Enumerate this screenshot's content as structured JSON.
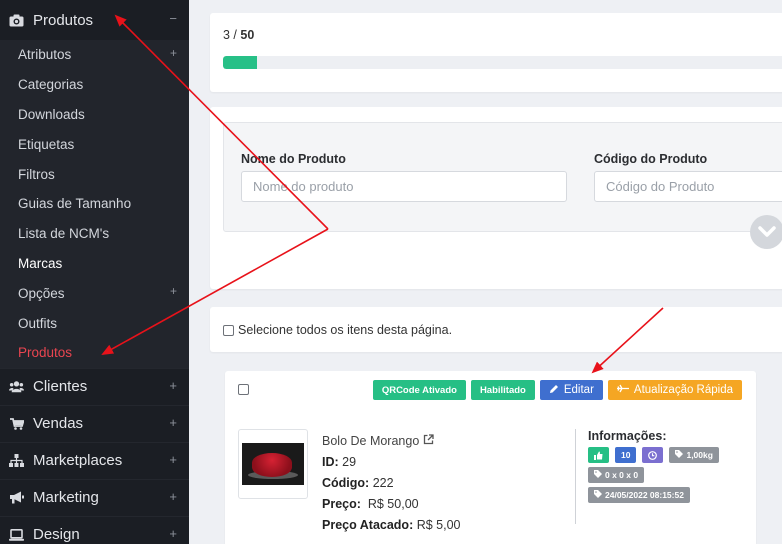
{
  "sidebar": {
    "top": {
      "label": "Produtos",
      "sign": "−"
    },
    "submenu": [
      {
        "label": "Atributos",
        "sign": "+"
      },
      {
        "label": "Categorias",
        "sign": ""
      },
      {
        "label": "Downloads",
        "sign": ""
      },
      {
        "label": "Etiquetas",
        "sign": ""
      },
      {
        "label": "Filtros",
        "sign": ""
      },
      {
        "label": "Guias de Tamanho",
        "sign": ""
      },
      {
        "label": "Lista de NCM's",
        "sign": ""
      },
      {
        "label": "Marcas",
        "sign": ""
      },
      {
        "label": "Opções",
        "sign": "+"
      },
      {
        "label": "Outfits",
        "sign": ""
      },
      {
        "label": "Produtos",
        "sign": ""
      }
    ],
    "main": [
      {
        "label": "Clientes",
        "sign": "+"
      },
      {
        "label": "Vendas",
        "sign": "+"
      },
      {
        "label": "Marketplaces",
        "sign": "+"
      },
      {
        "label": "Marketing",
        "sign": "+"
      },
      {
        "label": "Design",
        "sign": "+"
      }
    ]
  },
  "progress": {
    "current": "3",
    "separator": " / ",
    "total": "50",
    "fraction": 0.06
  },
  "filters": {
    "name_label": "Nome do Produto",
    "name_placeholder": "Nome do produto",
    "code_label": "Código do Produto",
    "code_placeholder": "Código do Produto"
  },
  "select_all": {
    "label": "Selecione todos os itens desta página."
  },
  "product": {
    "badges": {
      "qrcode": "QRCode Ativado",
      "enabled": "Habilitado",
      "edit": "Editar",
      "quick_update": "Atualização Rápida"
    },
    "name": "Bolo De Morango",
    "id_label": "ID:",
    "id": "29",
    "code_label": "Código:",
    "code": "222",
    "price_label": "Preço:",
    "price": "R$ 50,00",
    "wholesale_label": "Preço Atacado:",
    "wholesale": "R$ 5,00",
    "info": {
      "title": "Informações:",
      "count": "10",
      "weight": "1,00kg",
      "dimensions": "0 x 0 x 0",
      "date": "24/05/2022 08:15:52"
    }
  },
  "colors": {
    "sidebar_bg": "#1b1e24",
    "active": "#e94550",
    "green": "#26bf85",
    "blue": "#3f6fcf",
    "orange": "#f5a623",
    "arrow": "#e8121a"
  }
}
